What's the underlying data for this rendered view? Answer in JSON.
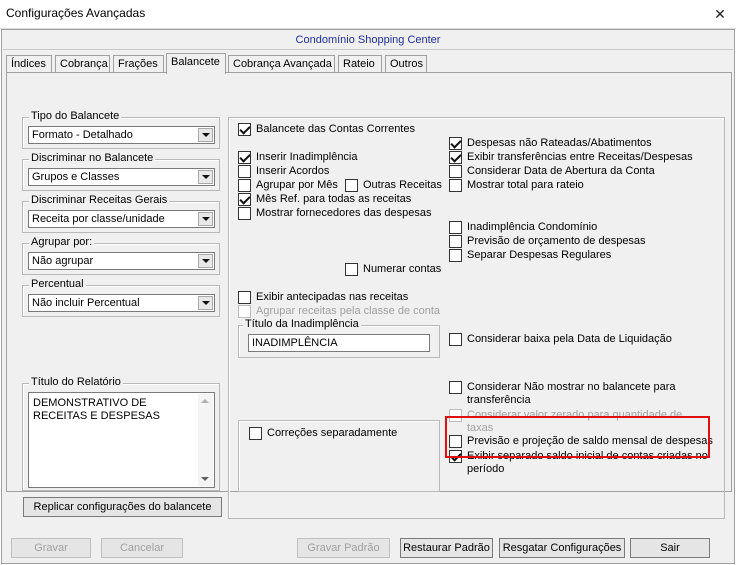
{
  "window": {
    "title": "Configurações Avançadas",
    "close_glyph": "✕"
  },
  "condominium": "Condomínio Shopping Center",
  "tabs": [
    {
      "label": "Índices"
    },
    {
      "label": "Cobrança"
    },
    {
      "label": "Frações"
    },
    {
      "label": "Balancete",
      "active": true
    },
    {
      "label": "Cobrança Avançada"
    },
    {
      "label": "Rateio"
    },
    {
      "label": "Outros"
    }
  ],
  "left": {
    "tipo_balancete": {
      "label": "Tipo do Balancete",
      "value": "Formato - Detalhado"
    },
    "discriminar_balancete": {
      "label": "Discriminar no Balancete",
      "value": "Grupos e Classes"
    },
    "discriminar_receitas": {
      "label": "Discriminar Receitas Gerais",
      "value": "Receita por classe/unidade"
    },
    "agrupar_por": {
      "label": "Agrupar por:",
      "value": "Não agrupar"
    },
    "percentual": {
      "label": "Percentual",
      "value": "Não incluir Percentual"
    },
    "titulo_relatorio": {
      "label": "Título do Relatório",
      "value": "DEMONSTRATIVO DE RECEITAS E DESPESAS"
    },
    "replicar_button": "Replicar configurações do balancete"
  },
  "options": {
    "balancete_contas_correntes": "Balancete das Contas Correntes",
    "inserir_inadimplencia": "Inserir Inadimplência",
    "inserir_acordos": "Inserir Acordos",
    "agrupar_por_mes": "Agrupar por Mês",
    "outras_receitas": "Outras Receitas",
    "mes_ref": "Mês Ref. para todas as receitas",
    "mostrar_fornecedores": "Mostrar fornecedores das despesas",
    "numerar_contas": "Numerar contas",
    "exibir_antecipadas": "Exibir antecipadas nas receitas",
    "agrupar_receitas_classe": "Agrupar receitas pela classe de conta",
    "titulo_inadimplencia_label": "Título da Inadimplência",
    "titulo_inadimplencia_value": "INADIMPLÊNCIA",
    "correcoes_separadamente": "Correções separadamente",
    "despesas_nao_rateadas": "Despesas não Rateadas/Abatimentos",
    "exibir_transferencias": "Exibir transferências entre Receitas/Despesas",
    "considerar_data_abertura": "Considerar Data de Abertura da Conta",
    "mostrar_total_rateio": "Mostrar total para rateio",
    "inadimplencia_condominio": "Inadimplência Condomínio",
    "previsao_orcamento": "Previsão de orçamento de despesas",
    "separar_despesas_regulares": "Separar Despesas Regulares",
    "considerar_baixa": "Considerar baixa pela Data de Liquidação",
    "considerar_nao_mostrar": "Considerar Não mostrar no balancete para transferência",
    "considerar_valor_zerado": "Considerar valor zerado para quantidade de taxas",
    "previsao_projecao": "Previsão e projeção de saldo mensal de despesas",
    "exibir_saldo_inicial": "Exibir separado saldo inicial de contas criadas no período"
  },
  "footer": {
    "gravar": "Gravar",
    "cancelar": "Cancelar",
    "gravar_padrao": "Gravar Padrão",
    "restaurar_padrao": "Restaurar Padrão",
    "resgatar_configuracoes": "Resgatar Configurações",
    "sair": "Sair"
  },
  "colors": {
    "highlight": "#e01010",
    "condo_text": "#1f2f9e"
  }
}
